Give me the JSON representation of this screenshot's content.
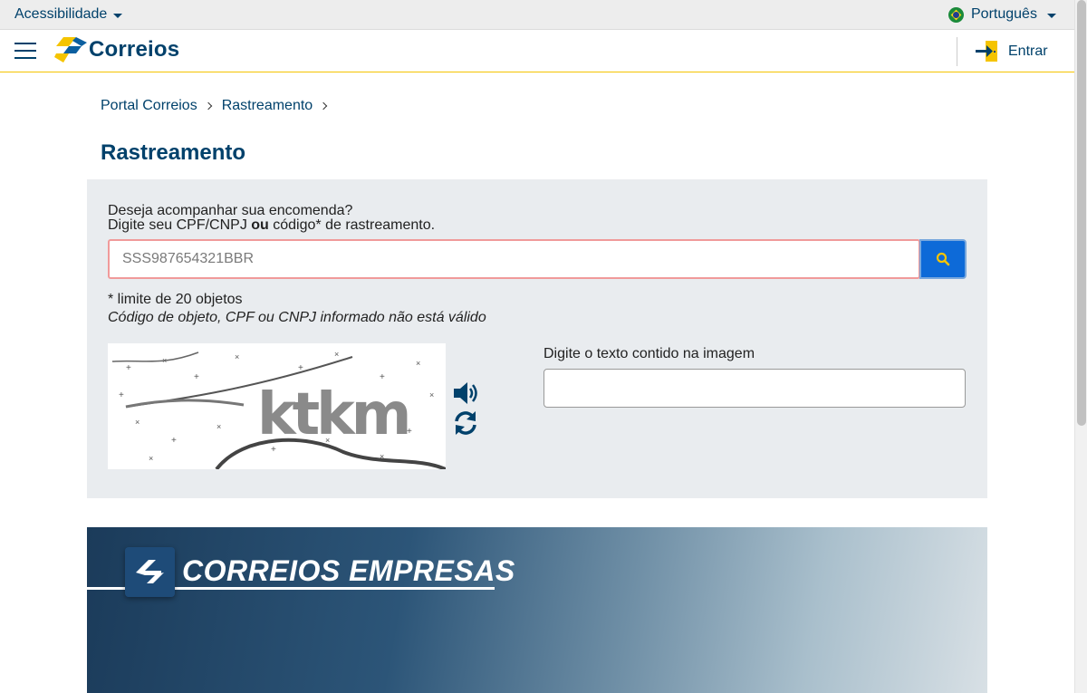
{
  "topbar": {
    "accessibility_label": "Acessibilidade",
    "language_label": "Português"
  },
  "header": {
    "logo_text": "Correios",
    "login_label": "Entrar"
  },
  "breadcrumb": {
    "items": [
      "Portal Correios",
      "Rastreamento"
    ]
  },
  "page": {
    "title": "Rastreamento"
  },
  "tracking": {
    "prompt_line1": "Deseja acompanhar sua encomenda?",
    "prompt_line2_prefix": "Digite seu CPF/CNPJ ",
    "prompt_line2_bold": "ou",
    "prompt_line2_suffix": " código* de rastreamento.",
    "input_placeholder": "SSS987654321BBR",
    "limit_note": "* limite de 20 objetos",
    "error_message": "Código de objeto, CPF ou CNPJ informado não está válido"
  },
  "captcha": {
    "image_text": "ktkm",
    "label": "Digite o texto contido na imagem",
    "value": ""
  },
  "banner": {
    "title": "CORREIOS EMPRESAS"
  },
  "colors": {
    "brand_blue": "#00416b",
    "brand_yellow": "#f5c400",
    "search_button": "#0d6ad8",
    "error_border": "#f09a9a"
  }
}
